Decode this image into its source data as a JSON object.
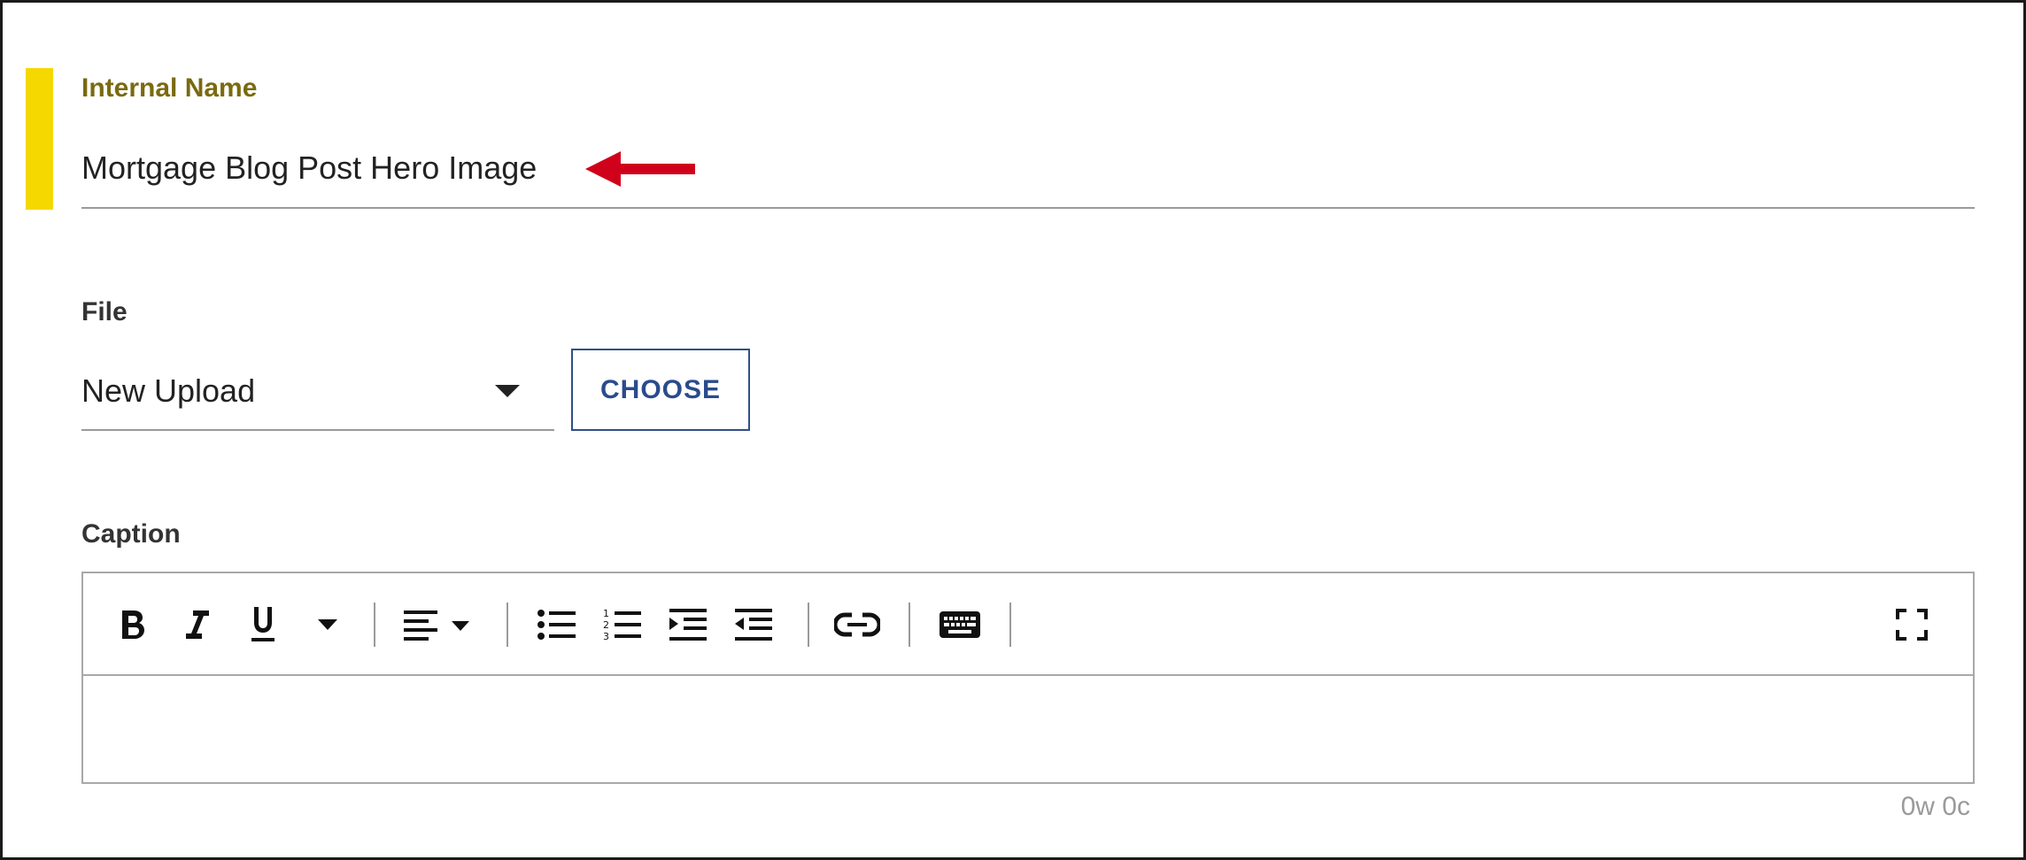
{
  "form": {
    "internal_name": {
      "label": "Internal Name",
      "value": "Mortgage Blog Post Hero Image"
    },
    "file": {
      "label": "File",
      "selected": "New Upload",
      "choose_label": "CHOOSE"
    },
    "caption": {
      "label": "Caption",
      "counter": "0w 0c",
      "toolbar": [
        {
          "id": "bold",
          "icon": "bold-icon"
        },
        {
          "id": "italic",
          "icon": "italic-icon"
        },
        {
          "id": "underline",
          "icon": "underline-icon"
        },
        {
          "id": "more-format",
          "icon": "caret-down-icon"
        },
        {
          "id": "align",
          "icon": "align-left-icon"
        },
        {
          "id": "bullet-list",
          "icon": "bulleted-list-icon"
        },
        {
          "id": "numbered-list",
          "icon": "numbered-list-icon"
        },
        {
          "id": "indent",
          "icon": "indent-icon"
        },
        {
          "id": "outdent",
          "icon": "outdent-icon"
        },
        {
          "id": "link",
          "icon": "link-icon"
        },
        {
          "id": "special-chars",
          "icon": "keyboard-icon"
        },
        {
          "id": "fullscreen",
          "icon": "fullscreen-icon"
        }
      ]
    }
  },
  "colors": {
    "accent_bar": "#f5d800",
    "active_label": "#7a6a10",
    "choose_button": "#2a4b8d",
    "annotation_arrow": "#d0021b"
  }
}
